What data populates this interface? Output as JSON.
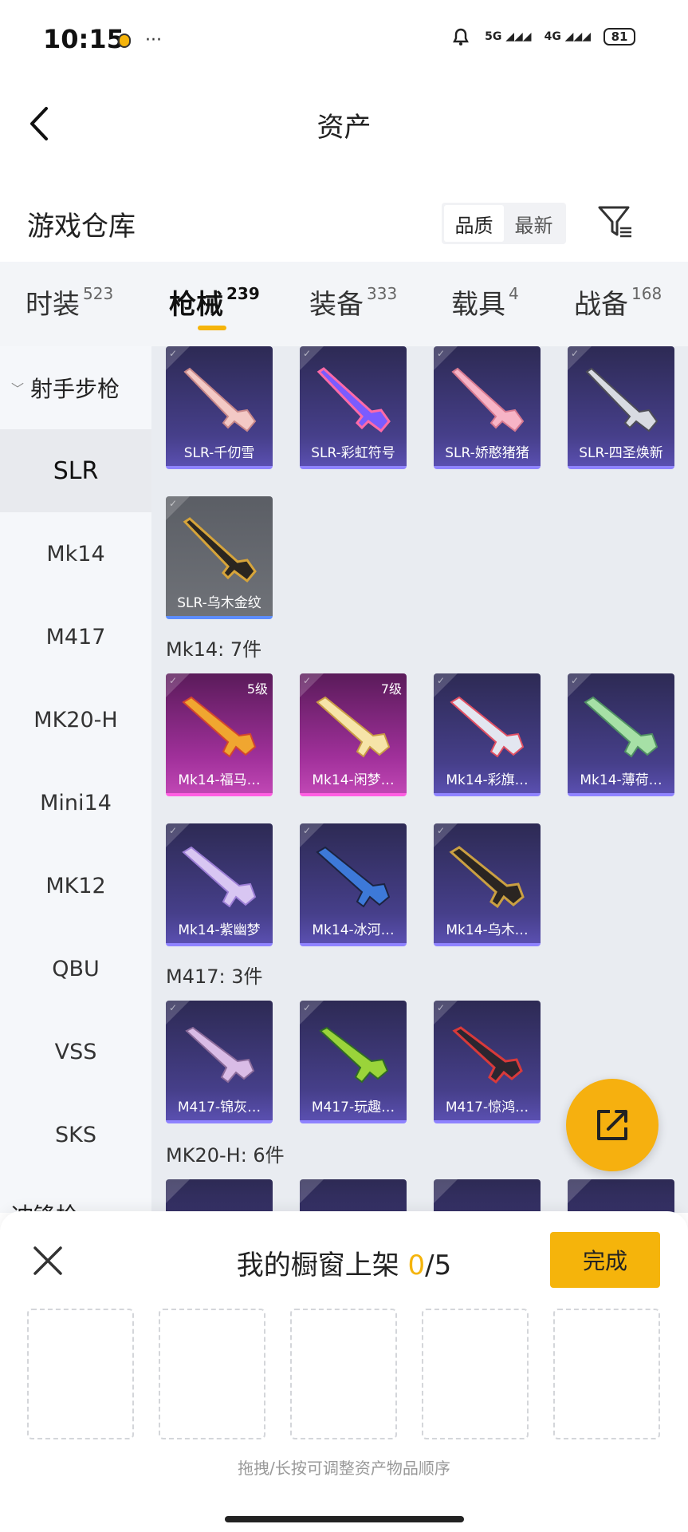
{
  "status_bar": {
    "time": "10:15",
    "more_dots": "···",
    "network_5g": "5G",
    "network_4g": "4G",
    "battery": "81"
  },
  "nav": {
    "title": "资产"
  },
  "warehouse": {
    "title": "游戏仓库",
    "sort_quality": "品质",
    "sort_newest": "最新"
  },
  "tabs": [
    {
      "label": "时装",
      "count": "523"
    },
    {
      "label": "枪械",
      "count": "239"
    },
    {
      "label": "装备",
      "count": "333"
    },
    {
      "label": "载具",
      "count": "4"
    },
    {
      "label": "战备",
      "count": "168"
    }
  ],
  "sidebar": {
    "group": "射手步枪",
    "items": [
      "SLR",
      "Mk14",
      "M417",
      "MK20-H",
      "Mini14",
      "MK12",
      "QBU",
      "VSS",
      "SKS"
    ],
    "next_group": "冲锋枪"
  },
  "groups": {
    "mk14": "Mk14: 7件",
    "m417": "M417: 3件",
    "mk20h": "MK20-H: 6件"
  },
  "items": {
    "slr": [
      {
        "name": "SLR-千仞雪"
      },
      {
        "name": "SLR-彩虹符号"
      },
      {
        "name": "SLR-娇憨猪猪"
      },
      {
        "name": "SLR-四圣焕新"
      },
      {
        "name": "SLR-乌木金纹"
      }
    ],
    "mk14": [
      {
        "name": "Mk14-福马…",
        "level": "5级"
      },
      {
        "name": "Mk14-闲梦…",
        "level": "7级"
      },
      {
        "name": "Mk14-彩旗…"
      },
      {
        "name": "Mk14-薄荷…"
      },
      {
        "name": "Mk14-紫幽梦"
      },
      {
        "name": "Mk14-冰河…"
      },
      {
        "name": "Mk14-乌木…"
      }
    ],
    "m417": [
      {
        "name": "M417-锦灰…"
      },
      {
        "name": "M417-玩趣…"
      },
      {
        "name": "M417-惊鸿…"
      }
    ]
  },
  "sheet": {
    "title_prefix": "我的橱窗上架 ",
    "count_current": "0",
    "count_total": "/5",
    "done": "完成",
    "hint": "拖拽/长按可调整资产物品顺序"
  },
  "colors": {
    "accent": "#f5b40b",
    "rarity_purple": "#8f83ff",
    "rarity_pink": "#ff5fe2",
    "rarity_blue": "#5c8dff"
  }
}
